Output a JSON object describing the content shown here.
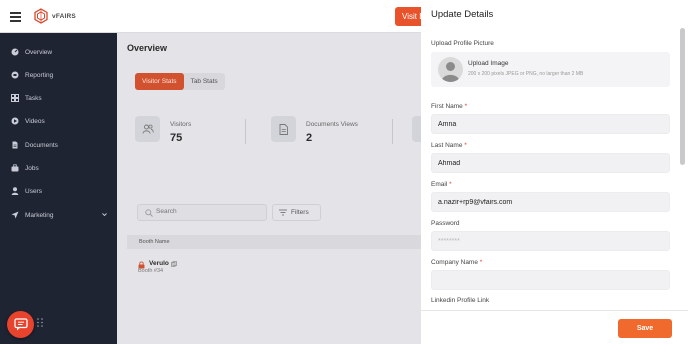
{
  "header": {
    "logo_text": "vFAIRS",
    "visit_button_label": "Visit B"
  },
  "sidebar": {
    "items": [
      {
        "label": "Overview",
        "icon": "dashboard-icon"
      },
      {
        "label": "Reporting",
        "icon": "reporting-icon"
      },
      {
        "label": "Tasks",
        "icon": "tasks-icon"
      },
      {
        "label": "Videos",
        "icon": "play-icon"
      },
      {
        "label": "Documents",
        "icon": "document-icon"
      },
      {
        "label": "Jobs",
        "icon": "briefcase-icon"
      },
      {
        "label": "Users",
        "icon": "user-icon"
      },
      {
        "label": "Marketing",
        "icon": "send-icon"
      }
    ]
  },
  "main": {
    "title": "Overview",
    "tabs": [
      {
        "label": "Visitor Stats",
        "active": true
      },
      {
        "label": "Tab Stats",
        "active": false
      }
    ],
    "stats": [
      {
        "label": "Visitors",
        "value": "75"
      },
      {
        "label": "Documents Views",
        "value": "2"
      }
    ],
    "search_placeholder": "Search",
    "filters_label": "Filters",
    "table_header": "Booth Name",
    "booth": {
      "name": "Verulo",
      "number": "Booth #34"
    }
  },
  "modal": {
    "title": "Update Details",
    "upload": {
      "label": "Upload Profile Picture",
      "title": "Upload Image",
      "hint": "200 x 200 pixels JPEG or PNG, no larger than 2 MB"
    },
    "fields": {
      "first_name": {
        "label": "First Name",
        "value": "Amna"
      },
      "last_name": {
        "label": "Last Name",
        "value": "Ahmad"
      },
      "email": {
        "label": "Email",
        "value": "a.nazir+rp9@vfairs.com"
      },
      "password": {
        "label": "Password",
        "placeholder": "********"
      },
      "company": {
        "label": "Company Name",
        "value": ""
      },
      "linkedin": {
        "label": "Linkedin Profile Link"
      }
    },
    "required_marker": "*",
    "save_label": "Save"
  },
  "colors": {
    "accent": "#f06a2d",
    "sidebar_bg": "#1f2433",
    "required": "#e23b2a"
  }
}
